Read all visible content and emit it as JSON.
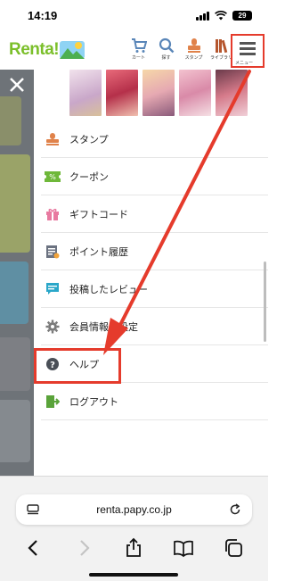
{
  "status_bar": {
    "time": "14:19",
    "battery": "29"
  },
  "header": {
    "logo_text": "Renta!",
    "nav": [
      {
        "label": "カート",
        "icon": "cart-icon"
      },
      {
        "label": "探す",
        "icon": "search-icon"
      },
      {
        "label": "スタンプ",
        "icon": "stamp-icon"
      },
      {
        "label": "ライブラリ",
        "icon": "library-icon"
      }
    ],
    "menu_label": "メニュー"
  },
  "menu": {
    "items": [
      {
        "label": "スタンプ",
        "icon": "stamp-icon"
      },
      {
        "label": "クーポン",
        "icon": "coupon-icon"
      },
      {
        "label": "ギフトコード",
        "icon": "gift-icon"
      },
      {
        "label": "ポイント履歴",
        "icon": "point-history-icon"
      },
      {
        "label": "投稿したレビュー",
        "icon": "review-icon"
      },
      {
        "label": "会員情報の設定",
        "icon": "gear-icon"
      },
      {
        "label": "ヘルプ",
        "icon": "help-icon"
      },
      {
        "label": "ログアウト",
        "icon": "logout-icon"
      }
    ]
  },
  "browser": {
    "url": "renta.papy.co.jp"
  },
  "colors": {
    "brand_green": "#7bbf2a",
    "annotation_red": "#e53b2c",
    "overlay": "#6e7378"
  }
}
